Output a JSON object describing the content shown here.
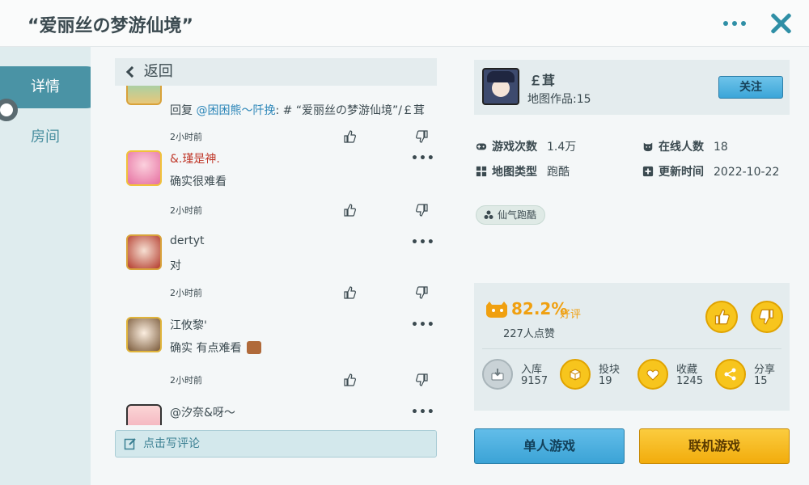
{
  "header": {
    "title": "“爱丽丝の梦游仙境”"
  },
  "sidebar": {
    "items": [
      {
        "label": "详情"
      },
      {
        "label": "房间"
      }
    ]
  },
  "comments": {
    "back_label": "返回",
    "write_label": "点击写评论",
    "items": [
      {
        "user": "",
        "text_prefix": "回复 ",
        "mention": "@困困熊～阡挽",
        "text_suffix": ": # “爱丽丝の梦游仙境”/￡茸",
        "time": "2小时前"
      },
      {
        "user": "&.瑾是神.",
        "text": "确实很难看",
        "time": "2小时前"
      },
      {
        "user": "dertyt",
        "text": "对",
        "time": "2小时前"
      },
      {
        "user": "江攸黎'",
        "text": "确实 有点难看",
        "time": "2小时前"
      },
      {
        "user": "@汐奈&呀～",
        "text": "",
        "time": ""
      }
    ]
  },
  "map": {
    "author": "￡茸",
    "works": "地图作品:15",
    "follow_label": "关注",
    "stats": {
      "plays_label": "游戏次数",
      "plays_value": "1.4万",
      "online_label": "在线人数",
      "online_value": "18",
      "type_label": "地图类型",
      "type_value": "跑酷",
      "updated_label": "更新时间",
      "updated_value": "2022-10-22"
    },
    "tag": "仙气跑酷"
  },
  "rating": {
    "percent": "82.2%",
    "word": "好评",
    "count": "227人点赞",
    "actions": [
      {
        "label": "入库",
        "value": "9157"
      },
      {
        "label": "投块",
        "value": "19"
      },
      {
        "label": "收藏",
        "value": "1245"
      },
      {
        "label": "分享",
        "value": "15"
      }
    ]
  },
  "buttons": {
    "single": "单人游戏",
    "multi": "联机游戏"
  },
  "colors": {
    "accent": "#4a93a5",
    "gold": "#f7c51d",
    "blue_btn": "#3ba3d6",
    "orange_btn": "#f2ac0c"
  }
}
